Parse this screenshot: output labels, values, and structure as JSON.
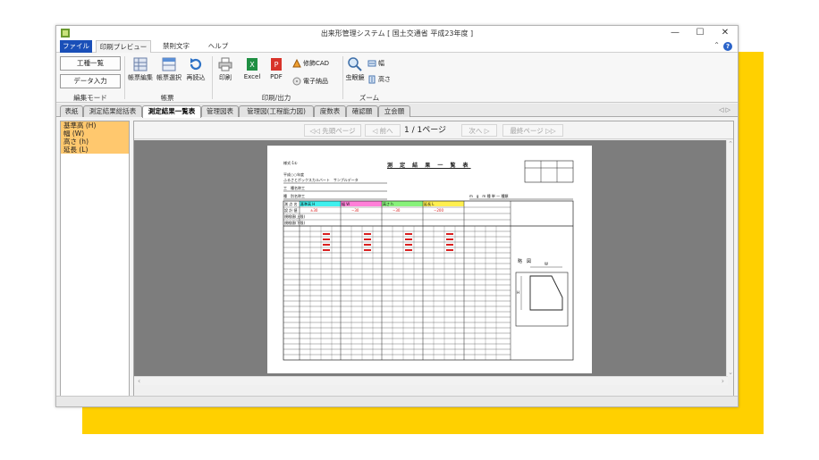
{
  "window": {
    "title": "出来形管理システム [ 国土交通省 平成23年度 ]",
    "controls": {
      "minimize": "—",
      "maximize": "☐",
      "close": "✕"
    }
  },
  "menu": {
    "items": [
      "ファイル",
      "印刷プレビュー",
      "禁則文字",
      "ヘルプ"
    ],
    "right_ctl": "⌃",
    "help": "?"
  },
  "ribbon": {
    "edit_mode": {
      "buttons": [
        "工種一覧",
        "データ入力"
      ],
      "label": "編集モード"
    },
    "form": {
      "buttons": [
        "帳票編集",
        "帳票選択",
        "再読込"
      ],
      "label": "帳票"
    },
    "print_output": {
      "buttons": [
        "印刷",
        "Excel",
        "PDF"
      ],
      "small": [
        "修飾CAD",
        "電子納品"
      ],
      "label": "印刷/出力"
    },
    "zoom": {
      "buttons": [
        "虫眼鏡"
      ],
      "small": [
        "幅",
        "高さ"
      ],
      "label": "ズーム"
    }
  },
  "tabs": {
    "items": [
      "表紙",
      "測定結果総括表",
      "測定結果一覧表",
      "管理図表",
      "管理図(工程能力図)",
      "度数表",
      "確認願",
      "立会願"
    ],
    "active_index": 2,
    "arrows": "◁ ▷"
  },
  "left_panel": {
    "items": [
      "基準高 (H)",
      "幅 (W)",
      "高さ (h)",
      "延長 (L)"
    ]
  },
  "viewer": {
    "nav": {
      "first": "◁◁ 先頭ページ",
      "prev": "◁ 前へ",
      "page": "1 / 1ページ",
      "next": "次へ ▷",
      "last": "最終ページ ▷▷"
    },
    "scroll": {
      "up": "⌃",
      "down": "⌄",
      "left": "‹",
      "right": "›"
    }
  },
  "sheet": {
    "doc_no": "様式-1①",
    "title": "測 定 結 果 一 覧 表",
    "year": "平成○○年度",
    "work_name": "ふるさとボックスカルバート　サンプルデータ",
    "unit": "工　種名称工",
    "item": "種　別名称工",
    "measure_label": "m　g　m 種 単 一 種類",
    "col_headers": [
      "基準高 H",
      "幅 W",
      "高さ h",
      "延長 L"
    ],
    "headers_left": [
      "測 点 名",
      "設 計 値",
      "規格値(上限)",
      "規格値(下限)"
    ],
    "spec": [
      "±30",
      "−30",
      "−30",
      "−200"
    ],
    "diagram_caption": "略　図",
    "w_label": "W",
    "h_label": "H"
  },
  "colors": {
    "accent": "#ffd000",
    "file_menu": "#1a4fb8",
    "panel_item": "#ffc86e",
    "h_col": "#3ff0ee",
    "w_col": "#ff7fd8",
    "hh_col": "#87f27a",
    "l_col": "#ffef4f"
  }
}
